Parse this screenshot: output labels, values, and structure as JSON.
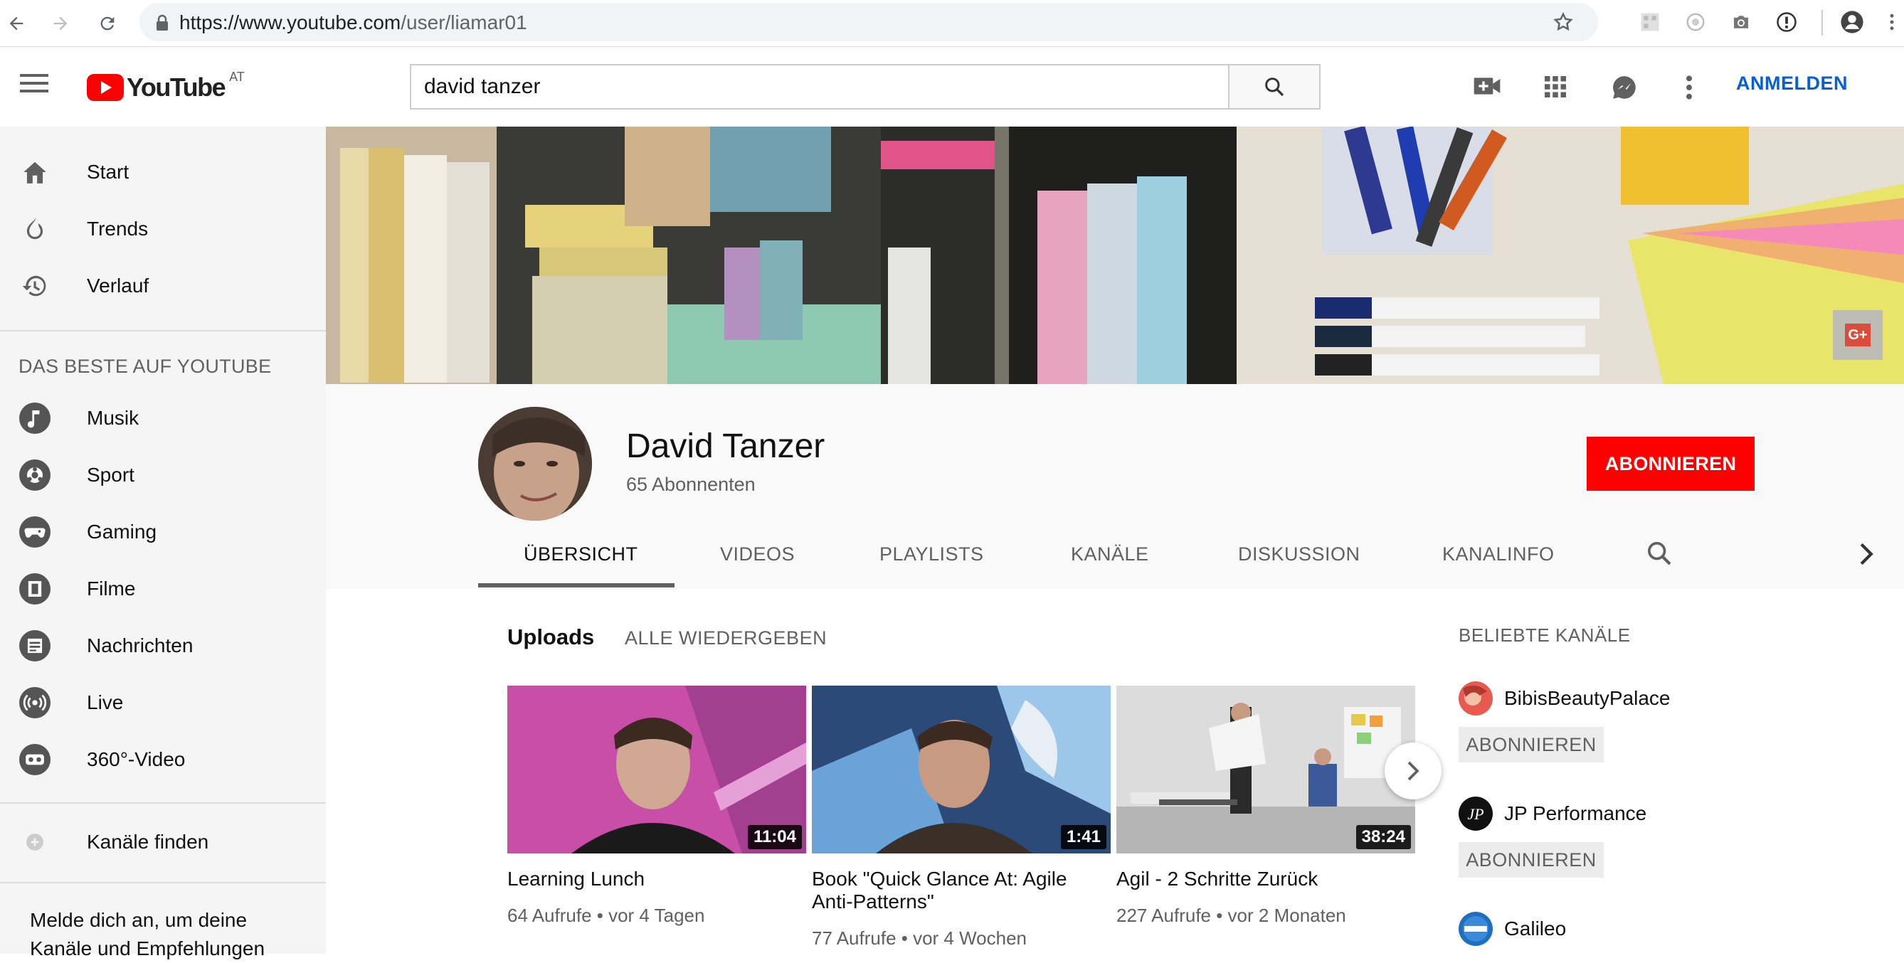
{
  "browser": {
    "url_scheme_host": "https://www.youtube.com",
    "url_path": "/user/liamar01"
  },
  "masthead": {
    "logo_text": "YouTube",
    "country_code": "AT",
    "search_value": "david tanzer",
    "signin_label": "ANMELDEN"
  },
  "sidebar": {
    "main_items": [
      {
        "label": "Start",
        "icon": "home-icon"
      },
      {
        "label": "Trends",
        "icon": "flame-icon"
      },
      {
        "label": "Verlauf",
        "icon": "history-icon"
      }
    ],
    "best_heading": "DAS BESTE AUF YOUTUBE",
    "best_items": [
      {
        "label": "Musik",
        "icon": "music-icon"
      },
      {
        "label": "Sport",
        "icon": "sport-icon"
      },
      {
        "label": "Gaming",
        "icon": "gaming-icon"
      },
      {
        "label": "Filme",
        "icon": "film-icon"
      },
      {
        "label": "Nachrichten",
        "icon": "news-icon"
      },
      {
        "label": "Live",
        "icon": "live-icon"
      },
      {
        "label": "360°-Video",
        "icon": "vr-icon"
      }
    ],
    "find_channels": "Kanäle finden",
    "signin_note": "Melde dich an, um deine Kanäle und Empfehlungen"
  },
  "channel": {
    "name": "David Tanzer",
    "subscribers": "65 Abonnenten",
    "subscribe_label": "ABONNIEREN",
    "tabs": [
      "ÜBERSICHT",
      "VIDEOS",
      "PLAYLISTS",
      "KANÄLE",
      "DISKUSSION",
      "KANALINFO"
    ]
  },
  "uploads": {
    "title": "Uploads",
    "play_all": "ALLE WIEDERGEBEN",
    "videos": [
      {
        "title": "Learning Lunch",
        "duration": "11:04",
        "meta": "64 Aufrufe • vor 4 Tagen"
      },
      {
        "title": "Book \"Quick Glance At: Agile Anti-Patterns\"",
        "duration": "1:41",
        "meta": "77 Aufrufe • vor 4 Wochen"
      },
      {
        "title": "Agil - 2 Schritte Zurück",
        "duration": "38:24",
        "meta": "227 Aufrufe • vor 2 Monaten"
      }
    ]
  },
  "popular": {
    "heading": "BELIEBTE KANÄLE",
    "channels": [
      {
        "name": "BibisBeautyPalace",
        "subscribe_label": "ABONNIEREN"
      },
      {
        "name": "JP Performance",
        "subscribe_label": "ABONNIEREN"
      },
      {
        "name": "Galileo"
      }
    ]
  },
  "colors": {
    "brand_red": "#ff0000",
    "link_blue": "#065fd4",
    "sidebar_bg": "#f5f5f5"
  }
}
